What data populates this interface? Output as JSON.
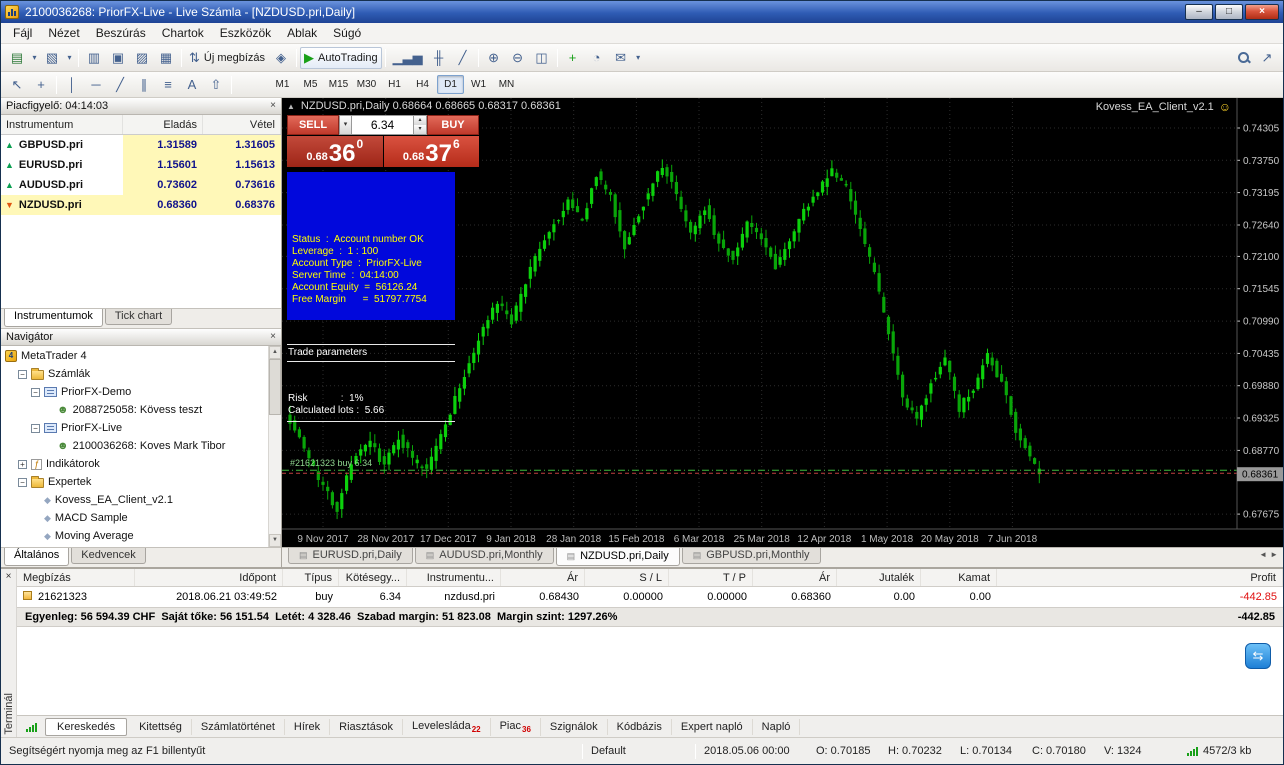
{
  "window": {
    "title": "2100036268: PriorFX-Live - Live Számla - [NZDUSD.pri,Daily]"
  },
  "icons": {
    "min": "–",
    "max": "□",
    "close_x": "×",
    "dropdown": "▾",
    "collapse": "▲",
    "smiley": "☺",
    "spin_up": "▴",
    "spin_down": "▾",
    "left": "◄",
    "right": "►",
    "chart_tab": "▤",
    "chat": "⇆",
    "up_arrow": "▲",
    "down_arrow": "▼"
  },
  "menu": {
    "items": [
      "Fájl",
      "Nézet",
      "Beszúrás",
      "Chartok",
      "Eszközök",
      "Ablak",
      "Súgó"
    ]
  },
  "toolbar": {
    "new_order": "Új megbízás",
    "autotrading": "AutoTrading",
    "main_items": [
      {
        "name": "new-chart-icon",
        "glyph": "▤",
        "color": "#2f7a3a"
      },
      {
        "name": "profiles-dropdown-icon",
        "glyph": "▾",
        "narrow": true
      },
      {
        "name": "profiles-icon",
        "glyph": "▧"
      },
      {
        "name": "chart-list-dropdown-icon",
        "glyph": "▾",
        "narrow": true
      },
      {
        "sep": true
      },
      {
        "name": "market-watch-icon",
        "glyph": "▥"
      },
      {
        "name": "data-window-icon",
        "glyph": "▣"
      },
      {
        "name": "navigator-icon",
        "glyph": "▨"
      },
      {
        "name": "terminal-icon",
        "glyph": "▦"
      },
      {
        "sep": true
      },
      {
        "name": "new-order-icon",
        "glyph": "⇅",
        "label_key": "new_order"
      },
      {
        "name": "metaeditor-icon",
        "glyph": "◈"
      },
      {
        "sep": true
      },
      {
        "name": "autotrading-icon",
        "glyph": "▶",
        "color": "#18a018",
        "label_key": "autotrading",
        "framed": true
      },
      {
        "sep": true
      },
      {
        "name": "bar-chart-icon",
        "glyph": "▁▃▅"
      },
      {
        "name": "candle-chart-icon",
        "glyph": "╫"
      },
      {
        "name": "line-chart-icon",
        "glyph": "╱"
      },
      {
        "sep": true
      },
      {
        "name": "zoom-in-icon",
        "glyph": "⊕"
      },
      {
        "name": "zoom-out-icon",
        "glyph": "⊖"
      },
      {
        "name": "tile-windows-icon",
        "glyph": "◫"
      },
      {
        "sep": true
      },
      {
        "name": "indicators-icon",
        "glyph": "+",
        "color": "#18a018"
      },
      {
        "name": "periods-icon",
        "glyph": "◔"
      },
      {
        "name": "templates-icon",
        "glyph": "✉"
      },
      {
        "name": "templates-dropdown-icon",
        "glyph": "▾",
        "narrow": true
      }
    ],
    "right_items": [
      {
        "name": "search-icon",
        "type": "magnifier"
      },
      {
        "name": "community-icon",
        "glyph": "↗"
      }
    ],
    "draw_items": [
      {
        "name": "cursor-icon",
        "glyph": "↖"
      },
      {
        "name": "crosshair-icon",
        "glyph": "+"
      },
      {
        "sep": true
      },
      {
        "name": "vertical-line-icon",
        "glyph": "│"
      },
      {
        "name": "horizontal-line-icon",
        "glyph": "─"
      },
      {
        "name": "trendline-icon",
        "glyph": "╱"
      },
      {
        "name": "channel-icon",
        "glyph": "∥"
      },
      {
        "name": "fibonacci-icon",
        "glyph": "≡"
      },
      {
        "name": "text-icon",
        "glyph": "A"
      },
      {
        "name": "arrows-icon",
        "glyph": "⇧"
      },
      {
        "sep": true
      }
    ]
  },
  "timeframes": {
    "items": [
      "M1",
      "M5",
      "M15",
      "M30",
      "H1",
      "H4",
      "D1",
      "W1",
      "MN"
    ],
    "active": "D1"
  },
  "market_watch": {
    "title": "Piacfigyelő: 04:14:03",
    "columns": [
      "Instrumentum",
      "Eladás",
      "Vétel"
    ],
    "rows": [
      {
        "symbol": "GBPUSD.pri",
        "bid": "1.31589",
        "ask": "1.31605",
        "dir": "up",
        "selected": false
      },
      {
        "symbol": "EURUSD.pri",
        "bid": "1.15601",
        "ask": "1.15613",
        "dir": "up",
        "selected": false
      },
      {
        "symbol": "AUDUSD.pri",
        "bid": "0.73602",
        "ask": "0.73616",
        "dir": "up",
        "selected": false
      },
      {
        "symbol": "NZDUSD.pri",
        "bid": "0.68360",
        "ask": "0.68376",
        "dir": "down",
        "selected": true
      }
    ],
    "tabs": [
      {
        "label": "Instrumentumok",
        "active": true
      },
      {
        "label": "Tick chart",
        "active": false
      }
    ]
  },
  "navigator": {
    "title": "Navigátor",
    "tree": [
      {
        "label": "MetaTrader 4",
        "level": 0,
        "icon": "mt4"
      },
      {
        "label": "Számlák",
        "level": 1,
        "icon": "folder",
        "expand": "minus"
      },
      {
        "label": "PriorFX-Demo",
        "level": 2,
        "icon": "server",
        "expand": "minus"
      },
      {
        "label": "2088725058: Kövess teszt",
        "level": 3,
        "icon": "account"
      },
      {
        "label": "PriorFX-Live",
        "level": 2,
        "icon": "server",
        "expand": "minus"
      },
      {
        "label": "2100036268: Koves Mark Tibor",
        "level": 3,
        "icon": "account"
      },
      {
        "label": "Indikátorok",
        "level": 1,
        "icon": "indicator",
        "expand": "plus"
      },
      {
        "label": "Expertek",
        "level": 1,
        "icon": "folder",
        "expand": "minus"
      },
      {
        "label": "Kovess_EA_Client_v2.1",
        "level": 2,
        "icon": "ea"
      },
      {
        "label": "MACD Sample",
        "level": 2,
        "icon": "ea"
      },
      {
        "label": "Moving Average",
        "level": 2,
        "icon": "ea"
      }
    ],
    "tabs": [
      {
        "label": "Általános",
        "active": true
      },
      {
        "label": "Kedvencek",
        "active": false
      }
    ]
  },
  "chart": {
    "header": "NZDUSD.pri,Daily  0.68664 0.68665 0.68317 0.68361",
    "ea_name": "Kovess_EA_Client_v2.1",
    "one_click": {
      "sell_label": "SELL",
      "buy_label": "BUY",
      "lots": "6.34",
      "bid_small": "0.68",
      "bid_big": "36",
      "bid_pip": "0",
      "ask_small": "0.68",
      "ask_big": "37",
      "ask_pip": "6"
    },
    "info_lines": [
      "Status  :  Account number OK",
      "Leverage  :  1 : 100",
      "Account Type  :  PriorFX-Live",
      "Server Time  :  04:14:00",
      "Account Equity  =  56126.24",
      "Free Margin      =  51797.7754"
    ],
    "params_title": "Trade parameters",
    "param_lines": [
      "Risk            :  1%",
      "Calculated lots :  5.66"
    ],
    "trade_label": "#21621323 buy 6.34",
    "tabs": [
      {
        "label": "EURUSD.pri,Daily",
        "active": false
      },
      {
        "label": "AUDUSD.pri,Monthly",
        "active": false
      },
      {
        "label": "NZDUSD.pri,Daily",
        "active": true
      },
      {
        "label": "GBPUSD.pri,Monthly",
        "active": false
      }
    ],
    "chart_data": {
      "type": "candlestick",
      "symbol": "NZDUSD.pri",
      "timeframe": "Daily",
      "bars": 160,
      "price_range": [
        0.6742,
        0.7482
      ],
      "y_labels": [
        "0.74305",
        "0.73750",
        "0.73195",
        "0.72640",
        "0.72100",
        "0.71545",
        "0.70990",
        "0.70435",
        "0.69880",
        "0.69325",
        "0.68770",
        "0.67675"
      ],
      "x_labels": [
        "9 Nov 2017",
        "28 Nov 2017",
        "17 Dec 2017",
        "9 Jan 2018",
        "28 Jan 2018",
        "15 Feb 2018",
        "6 Mar 2018",
        "25 Mar 2018",
        "12 Apr 2018",
        "1 May 2018",
        "20 May 2018",
        "7 Jun 2018"
      ],
      "current_bid": 0.68361,
      "current_ask": 0.68376,
      "trade_price": 0.6843,
      "anchors": [
        [
          0,
          0.6945
        ],
        [
          4,
          0.688
        ],
        [
          8,
          0.6812
        ],
        [
          11,
          0.6778
        ],
        [
          14,
          0.6858
        ],
        [
          18,
          0.6888
        ],
        [
          21,
          0.6852
        ],
        [
          24,
          0.6902
        ],
        [
          27,
          0.686
        ],
        [
          30,
          0.6842
        ],
        [
          34,
          0.6925
        ],
        [
          38,
          0.7005
        ],
        [
          42,
          0.709
        ],
        [
          45,
          0.7128
        ],
        [
          48,
          0.7098
        ],
        [
          52,
          0.7188
        ],
        [
          56,
          0.7252
        ],
        [
          60,
          0.7302
        ],
        [
          63,
          0.7268
        ],
        [
          66,
          0.7352
        ],
        [
          69,
          0.7312
        ],
        [
          72,
          0.7228
        ],
        [
          76,
          0.7302
        ],
        [
          80,
          0.7368
        ],
        [
          83,
          0.7315
        ],
        [
          86,
          0.7248
        ],
        [
          89,
          0.7295
        ],
        [
          92,
          0.7232
        ],
        [
          95,
          0.7208
        ],
        [
          98,
          0.7268
        ],
        [
          101,
          0.7238
        ],
        [
          104,
          0.7192
        ],
        [
          108,
          0.7258
        ],
        [
          112,
          0.7312
        ],
        [
          116,
          0.7358
        ],
        [
          119,
          0.7332
        ],
        [
          122,
          0.7252
        ],
        [
          125,
          0.7182
        ],
        [
          128,
          0.7078
        ],
        [
          131,
          0.6962
        ],
        [
          134,
          0.6928
        ],
        [
          137,
          0.6992
        ],
        [
          140,
          0.7035
        ],
        [
          143,
          0.6948
        ],
        [
          146,
          0.6986
        ],
        [
          149,
          0.7042
        ],
        [
          152,
          0.6992
        ],
        [
          155,
          0.6912
        ],
        [
          158,
          0.6862
        ],
        [
          160,
          0.6836
        ]
      ]
    }
  },
  "terminal": {
    "side_label": "Terminál",
    "columns": [
      "Megbízás",
      "Időpont",
      "Típus",
      "Kötésegy...",
      "Instrumentu...",
      "Ár",
      "S / L",
      "T / P",
      "Ár",
      "Jutalék",
      "Kamat",
      "Profit"
    ],
    "orders": [
      [
        "21621323",
        "2018.06.21 03:49:52",
        "buy",
        "6.34",
        "nzdusd.pri",
        "0.68430",
        "0.00000",
        "0.00000",
        "0.68360",
        "0.00",
        "0.00",
        "-442.85"
      ]
    ],
    "balance_line": "Egyenleg: 56 594.39 CHF  Saját tőke: 56 151.54  Letét: 4 328.46  Szabad margin: 51 823.08  Margin szint: 1297.26%",
    "balance_profit": "-442.85",
    "tabs": [
      {
        "label": "Kereskedés",
        "active": true
      },
      {
        "label": "Kitettség"
      },
      {
        "label": "Számlatörténet"
      },
      {
        "label": "Hírek"
      },
      {
        "label": "Riasztások"
      },
      {
        "label": "Levelesláda",
        "badge": "22"
      },
      {
        "label": "Piac",
        "badge": "36"
      },
      {
        "label": "Szignálok"
      },
      {
        "label": "Kódbázis"
      },
      {
        "label": "Expert napló"
      },
      {
        "label": "Napló"
      }
    ]
  },
  "status": {
    "help": "Segítségért nyomja meg az F1 billentyűt",
    "profile": "Default",
    "datetime": "2018.05.06 00:00",
    "ohlcv": [
      "O: 0.70185",
      "H: 0.70232",
      "L: 0.70134",
      "C: 0.70180",
      "V: 1324"
    ],
    "traffic": "4572/3 kb"
  }
}
